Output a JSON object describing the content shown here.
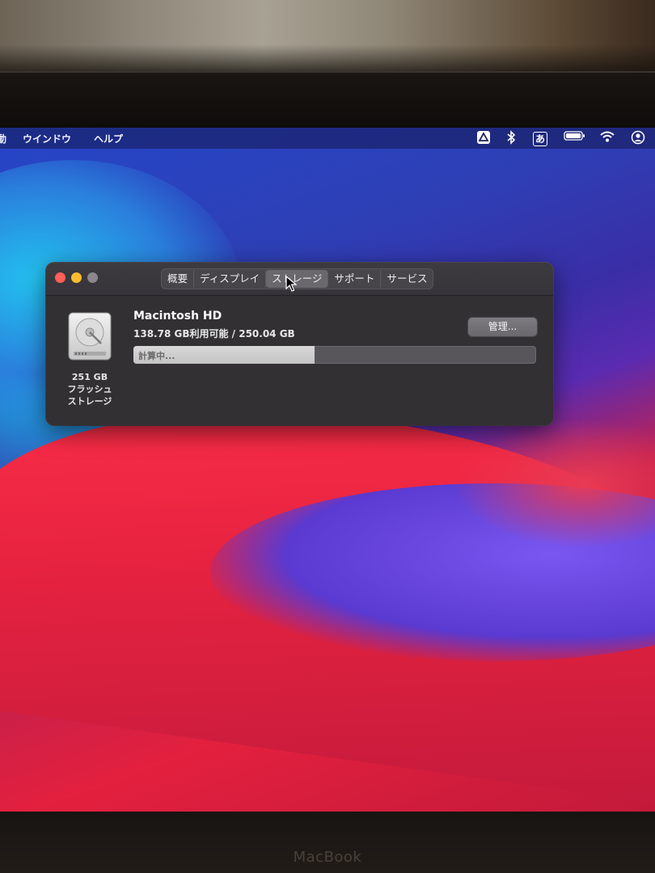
{
  "menubar": {
    "items": [
      "動",
      "ウインドウ",
      "ヘルプ"
    ],
    "status_icons": [
      "drive-icon",
      "bluetooth-icon",
      "input-method-icon",
      "battery-icon",
      "wifi-icon",
      "user-icon"
    ],
    "input_method_label": "あ"
  },
  "window": {
    "tabs": [
      "概要",
      "ディスプレイ",
      "ストレージ",
      "サポート",
      "サービス"
    ],
    "active_tab": "ストレージ",
    "traffic_lights": {
      "close": "#ff5f57",
      "minimize": "#febc2e",
      "zoom": "#8a888d"
    }
  },
  "storage": {
    "disk_label_lines": [
      "251 GB",
      "フラッシュ",
      "ストレージ"
    ],
    "volume_name": "Macintosh HD",
    "free_text": "138.78 GB利用可能 / 250.04 GB",
    "manage_label": "管理...",
    "bar_text": "計算中...",
    "used_fraction": 0.45
  },
  "bezel": {
    "brand": "MacBook"
  }
}
